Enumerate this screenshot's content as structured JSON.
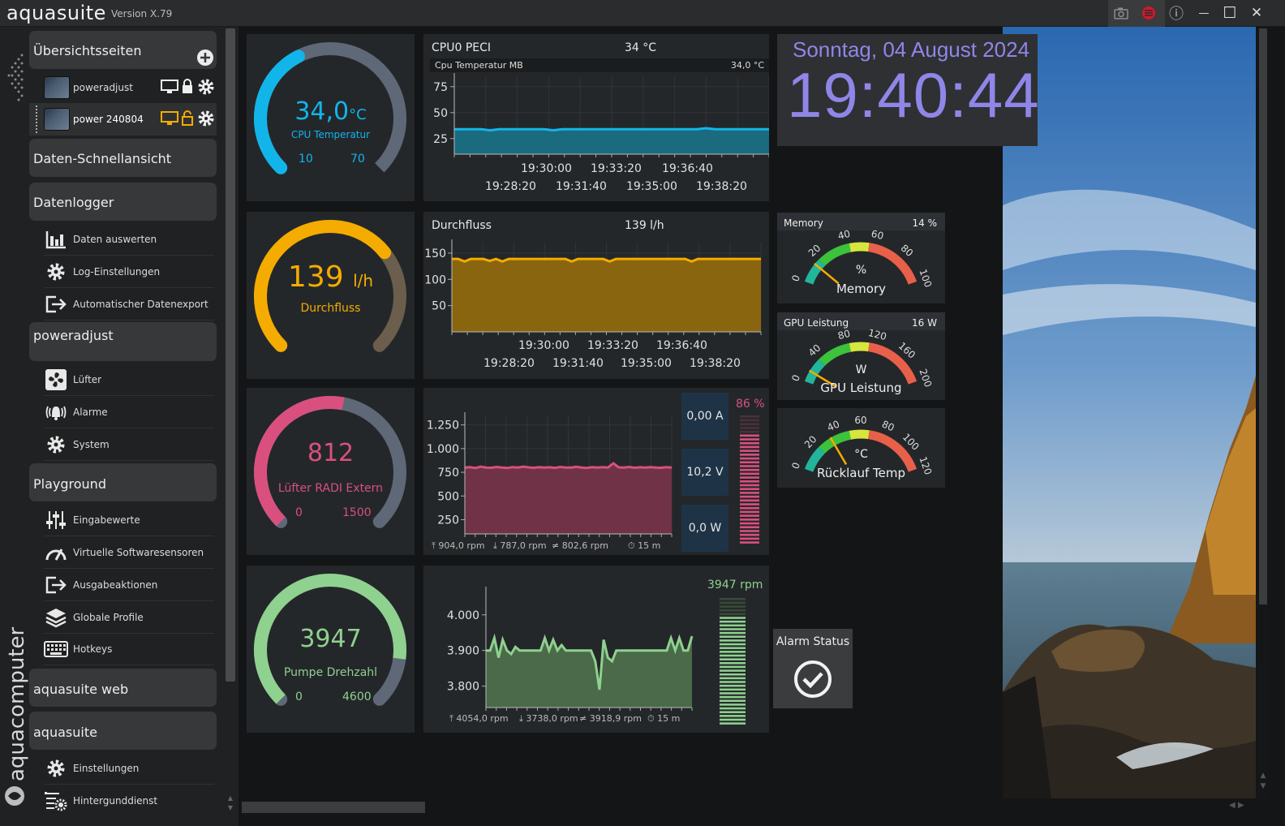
{
  "app": {
    "name": "aquasuite",
    "version": "Version X.79"
  },
  "window_controls": [
    {
      "name": "camera-icon"
    },
    {
      "name": "aquasuite-logo-icon"
    },
    {
      "name": "info-icon",
      "glyph": "ⓘ"
    },
    {
      "name": "minimize-icon",
      "glyph": "—"
    },
    {
      "name": "maximize-icon",
      "glyph": "☐"
    },
    {
      "name": "close-icon",
      "glyph": "✕"
    }
  ],
  "sidebar": {
    "brand_vertical": "aquacomputer",
    "sections": {
      "overview": {
        "label": "Übersichtsseiten"
      },
      "quickview": {
        "label": "Daten-Schnellansicht"
      },
      "logger": {
        "label": "Datenlogger"
      },
      "poweradjust": {
        "label": "poweradjust"
      },
      "playground": {
        "label": "Playground"
      },
      "web": {
        "label": "aquasuite web"
      },
      "aquasuite": {
        "label": "aquasuite"
      }
    },
    "pages": [
      {
        "label": "poweradjust"
      },
      {
        "label": "power 240804"
      }
    ],
    "logger_items": [
      {
        "label": "Daten auswerten",
        "icon": "bar-chart-icon"
      },
      {
        "label": "Log-Einstellungen",
        "icon": "gear-icon"
      },
      {
        "label": "Automatischer Datenexport",
        "icon": "export-icon"
      }
    ],
    "poweradjust_items": [
      {
        "label": "Lüfter",
        "icon": "fan-icon"
      },
      {
        "label": "Alarme",
        "icon": "alarm-bell-icon"
      },
      {
        "label": "System",
        "icon": "gear-icon"
      }
    ],
    "playground_items": [
      {
        "label": "Eingabewerte",
        "icon": "sliders-icon"
      },
      {
        "label": "Virtuelle Softwaresensoren",
        "icon": "gauge-icon"
      },
      {
        "label": "Ausgabeaktionen",
        "icon": "export-icon"
      },
      {
        "label": "Globale Profile",
        "icon": "layers-icon"
      },
      {
        "label": "Hotkeys",
        "icon": "keyboard-icon"
      }
    ],
    "aquasuite_items": [
      {
        "label": "Einstellungen",
        "icon": "gear-icon"
      },
      {
        "label": "Hintergunddienst",
        "icon": "service-icon"
      }
    ]
  },
  "gauges": {
    "cpu": {
      "value": "34,0",
      "unit": "°C",
      "label": "CPU Temperatur",
      "min": "10",
      "max": "70",
      "fraction": 0.4,
      "color": "#12b5ea"
    },
    "flow": {
      "value": "139",
      "unit": "l/h",
      "label": "Durchfluss",
      "fraction": 0.69,
      "color": "#f5ac00"
    },
    "fan": {
      "value": "812",
      "unit": "",
      "label": "Lüfter RADI Extern",
      "min": "0",
      "max": "1500",
      "fraction": 0.54,
      "color": "#d9507e"
    },
    "pump": {
      "value": "3947",
      "unit": "",
      "label": "Pumpe Drehzahl",
      "min": "0",
      "max": "4600",
      "fraction": 0.86,
      "color": "#8fd18f"
    }
  },
  "charts": {
    "cpu": {
      "title": "CPU0 PECI",
      "value": "34 °C",
      "series_label": "Cpu Temperatur MB",
      "series_value": "34,0 °C"
    },
    "flow": {
      "title": "Durchfluss",
      "value": "139 l/h"
    },
    "fan": {
      "stats": [
        "⤒ 904,0 rpm",
        "⤓ 787,0 rpm",
        "≠ 802,6 rpm",
        "⏱ 15 m"
      ]
    },
    "pump": {
      "stats": [
        "⤒ 4054,0 rpm",
        "⤓ 3738,0 rpm",
        "≠ 3918,9 rpm",
        "⏱ 15 m"
      ],
      "rpm_label": "3947 rpm"
    }
  },
  "chart_data": [
    {
      "type": "area",
      "title": "CPU0 PECI",
      "ylim": [
        10,
        85
      ],
      "yticks": [
        "75",
        "50",
        "25"
      ],
      "ytick_values": [
        75,
        50,
        25
      ],
      "xticks_top": [
        "19:30:00",
        "19:33:20",
        "19:36:40"
      ],
      "xticks_bottom": [
        "19:28:20",
        "19:31:40",
        "19:35:00",
        "19:38:20"
      ],
      "series": [
        {
          "name": "Cpu Temperatur MB",
          "values": [
            34,
            34,
            34,
            34,
            33,
            34,
            34,
            34,
            34,
            34,
            34,
            33,
            34,
            34,
            34,
            34,
            34,
            34,
            34,
            34,
            34,
            34,
            34,
            34,
            34,
            34,
            34,
            34,
            35,
            34,
            34,
            34,
            34,
            34,
            34,
            34
          ]
        }
      ]
    },
    {
      "type": "area",
      "title": "Durchfluss",
      "ylim": [
        0,
        170
      ],
      "yticks": [
        "150",
        "100",
        "50"
      ],
      "ytick_values": [
        150,
        100,
        50
      ],
      "xticks_top": [
        "19:30:00",
        "19:33:20",
        "19:36:40"
      ],
      "xticks_bottom": [
        "19:28:20",
        "19:31:40",
        "19:35:00",
        "19:38:20"
      ],
      "series": [
        {
          "name": "Durchfluss",
          "values": [
            139,
            139,
            134,
            139,
            139,
            139,
            135,
            139,
            134,
            139,
            139,
            139,
            139,
            139,
            139,
            139,
            139,
            139,
            139,
            134,
            139,
            139,
            139,
            139,
            139,
            134,
            139,
            139,
            139,
            139,
            139,
            139,
            139,
            139,
            139,
            139,
            139,
            139,
            134,
            139,
            139,
            139,
            139,
            139,
            139,
            139,
            139,
            139,
            139,
            139
          ]
        }
      ]
    },
    {
      "type": "area",
      "title": "",
      "ylim": [
        100,
        1350
      ],
      "yticks": [
        "1.250",
        "1.000",
        "750",
        "500",
        "250"
      ],
      "ytick_values": [
        1250,
        1000,
        750,
        500,
        250
      ],
      "series": [
        {
          "name": "Lüfter RADI Extern",
          "values": [
            800,
            805,
            795,
            810,
            800,
            798,
            806,
            800,
            795,
            805,
            800,
            810,
            802,
            798,
            805,
            800,
            803,
            797,
            806,
            800,
            800,
            808,
            800,
            796,
            804,
            800,
            805,
            800,
            845,
            802,
            800,
            806,
            798,
            803,
            800,
            805,
            800,
            798,
            805,
            800
          ]
        }
      ]
    },
    {
      "type": "area",
      "title": "",
      "ylim": [
        3740,
        4070
      ],
      "yticks": [
        "4.000",
        "3.900",
        "3.800"
      ],
      "ytick_values": [
        4000,
        3900,
        3800
      ],
      "series": [
        {
          "name": "Pumpe Drehzahl",
          "values": [
            3900,
            3900,
            3935,
            3880,
            3930,
            3900,
            3890,
            3910,
            3900,
            3900,
            3900,
            3900,
            3900,
            3900,
            3935,
            3900,
            3930,
            3900,
            3915,
            3900,
            3900,
            3900,
            3900,
            3900,
            3900,
            3900,
            3870,
            3790,
            3930,
            3880,
            3870,
            3900,
            3900,
            3900,
            3900,
            3900,
            3900,
            3900,
            3900,
            3900,
            3900,
            3900,
            3900,
            3900,
            3935,
            3900,
            3935,
            3900,
            3900,
            3940
          ]
        }
      ]
    }
  ],
  "datetime": {
    "date": "Sonntag, 04 August 2024",
    "time": "19:40:44"
  },
  "tiles": [
    {
      "label": "0,00 A"
    },
    {
      "label": "10,2 V"
    },
    {
      "label": "0,0 W"
    }
  ],
  "fan_percent": {
    "label": "86 %",
    "fraction": 0.86
  },
  "pump_bar_fraction": 0.86,
  "meters": {
    "memory": {
      "title": "Memory",
      "value": "14 %",
      "unit": "%",
      "label": "Memory",
      "ticks": [
        "0",
        "20",
        "40",
        "60",
        "80",
        "100"
      ],
      "min": 0,
      "max": 100,
      "reading": 14
    },
    "gpu": {
      "title": "GPU Leistung",
      "value": "16 W",
      "unit": "W",
      "label": "GPU Leistung",
      "ticks": [
        "0",
        "40",
        "80",
        "120",
        "160",
        "200"
      ],
      "min": 0,
      "max": 200,
      "reading": 16
    },
    "return": {
      "title": "",
      "value": "",
      "unit": "°C",
      "label": "Rücklauf Temp",
      "ticks": [
        "0",
        "20",
        "40",
        "60",
        "80",
        "100",
        "120"
      ],
      "min": 0,
      "max": 120,
      "reading": 34
    }
  },
  "alarm": {
    "title": "Alarm Status"
  },
  "colors": {
    "cpu": "#12b5ea",
    "flow": "#f5ac00",
    "fan": "#d9507e",
    "pump": "#8fd18f",
    "clock": "#8f86e8"
  }
}
